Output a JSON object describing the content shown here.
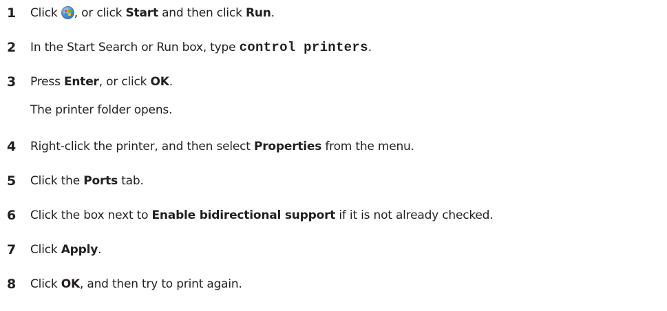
{
  "steps": [
    {
      "num": "1",
      "a": "Click ",
      "b": ", or click ",
      "c": "Start",
      "d": " and then click ",
      "e": "Run",
      "f": "."
    },
    {
      "num": "2",
      "a": "In the Start Search or Run box, type ",
      "code": "control printers",
      "b": "."
    },
    {
      "num": "3",
      "a": "Press ",
      "b": "Enter",
      "c": ", or click ",
      "d": "OK",
      "e": "."
    },
    {
      "note": "The printer folder opens."
    },
    {
      "num": "4",
      "a": "Right-click the printer, and then select ",
      "b": "Properties",
      "c": " from the menu."
    },
    {
      "num": "5",
      "a": "Click the ",
      "b": "Ports",
      "c": " tab."
    },
    {
      "num": "6",
      "a": "Click the box next to ",
      "b": "Enable bidirectional support",
      "c": " if it is not already checked."
    },
    {
      "num": "7",
      "a": "Click ",
      "b": "Apply",
      "c": "."
    },
    {
      "num": "8",
      "a": "Click ",
      "b": "OK",
      "c": ", and then try to print again."
    }
  ],
  "icons": {
    "start_button": "windows-start-orb-icon"
  }
}
